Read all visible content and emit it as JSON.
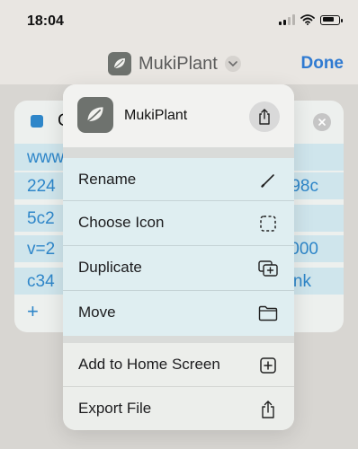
{
  "status_bar": {
    "time": "18:04",
    "wifi_icon": "wifi-icon",
    "battery_level": 0.75
  },
  "nav": {
    "title": "MukiPlant",
    "done_label": "Done"
  },
  "background_card": {
    "header_text": "C",
    "rows": [
      {
        "left": "www",
        "right": ""
      },
      {
        "left": "224",
        "right": "98c"
      },
      {
        "left": "5c2",
        "right": ""
      },
      {
        "left": "v=2",
        "right": "000"
      },
      {
        "left": "c34",
        "right": "nk"
      }
    ],
    "add_symbol": "+"
  },
  "menu": {
    "app_name": "MukiPlant",
    "items_group1": [
      {
        "label": "Rename",
        "icon": "pencil-icon"
      },
      {
        "label": "Choose Icon",
        "icon": "dashed-square-icon"
      },
      {
        "label": "Duplicate",
        "icon": "duplicate-icon"
      },
      {
        "label": "Move",
        "icon": "folder-icon"
      }
    ],
    "items_group2": [
      {
        "label": "Add to Home Screen",
        "icon": "plus-square-icon"
      },
      {
        "label": "Export File",
        "icon": "export-icon"
      }
    ]
  }
}
